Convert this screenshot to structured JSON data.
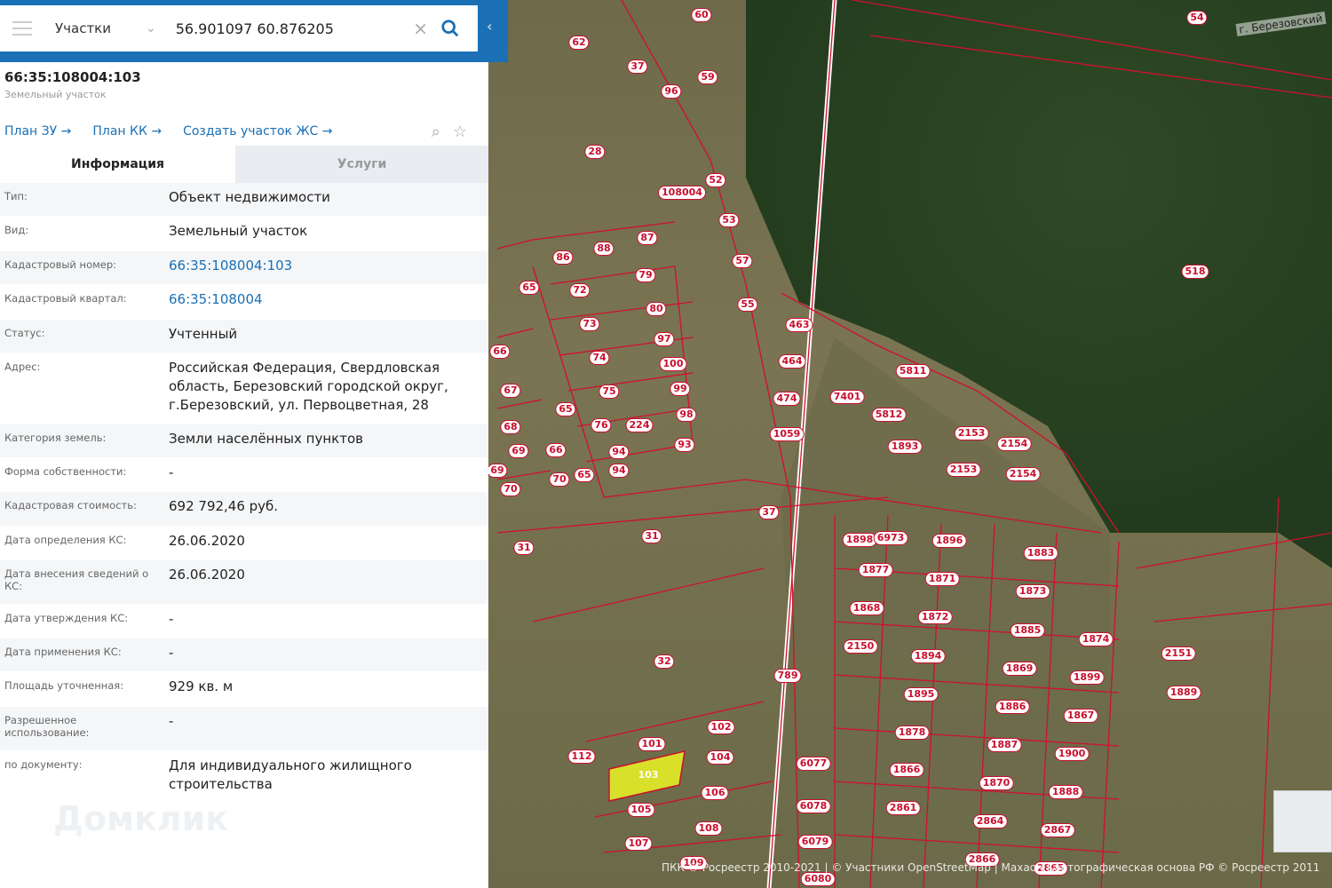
{
  "search": {
    "layer": "Участки",
    "query": "56.901097 60.876205"
  },
  "object": {
    "cadastral_number": "66:35:108004:103",
    "type_label": "Земельный участок"
  },
  "links": [
    "План ЗУ →",
    "План КК →",
    "Создать участок ЖС →"
  ],
  "tabs": [
    "Информация",
    "Услуги"
  ],
  "rows": [
    {
      "k": "Тип:",
      "v": "Объект недвижимости"
    },
    {
      "k": "Вид:",
      "v": "Земельный участок"
    },
    {
      "k": "Кадастровый номер:",
      "v": "66:35:108004:103"
    },
    {
      "k": "Кадастровый квартал:",
      "v": "66:35:108004"
    },
    {
      "k": "Статус:",
      "v": "Учтенный"
    },
    {
      "k": "Адрес:",
      "v": "Российская Федерация, Свердловская область, Березовский городской округ, г.Березовский, ул. Первоцветная, 28"
    },
    {
      "k": "Категория земель:",
      "v": "Земли населённых пунктов"
    },
    {
      "k": "Форма собственности:",
      "v": "-"
    },
    {
      "k": "Кадастровая стоимость:",
      "v": "692 792,46 руб."
    },
    {
      "k": "Дата определения КС:",
      "v": "26.06.2020"
    },
    {
      "k": "Дата внесения сведений о КС:",
      "v": "26.06.2020"
    },
    {
      "k": "Дата утверждения КС:",
      "v": "-"
    },
    {
      "k": "Дата применения КС:",
      "v": "-"
    },
    {
      "k": "Площадь уточненная:",
      "v": "929 кв. м"
    },
    {
      "k": "Разрешенное использование:",
      "v": "-"
    },
    {
      "k": "по документу:",
      "v": "Для индивидуального жилищного строительства"
    }
  ],
  "watermark": "Домклик",
  "map": {
    "street": "г. Березовский",
    "attribution": "ПКК © Росреестр 2010-2021 | © Участники OpenStreetMap | Махаон Картографическая основа РФ © Росреестр 2011",
    "labels": [
      "60",
      "62",
      "54",
      "37",
      "59",
      "96",
      "28",
      "108004",
      "53",
      "52",
      "57",
      "88",
      "87",
      "86",
      "79",
      "72",
      "55",
      "80",
      "73",
      "97",
      "74",
      "100",
      "75",
      "99",
      "76",
      "224",
      "98",
      "94",
      "93",
      "94",
      "31",
      "37",
      "31",
      "518",
      "463",
      "464",
      "474",
      "1059",
      "7401",
      "5811",
      "5812",
      "2153",
      "2154",
      "1893",
      "2153",
      "2154",
      "1898",
      "6973",
      "1896",
      "1883",
      "1877",
      "1871",
      "1873",
      "1868",
      "1872",
      "1885",
      "2150",
      "1894",
      "1874",
      "2151",
      "1869",
      "1895",
      "1899",
      "1886",
      "1867",
      "1889",
      "32",
      "101",
      "102",
      "103",
      "104",
      "106",
      "105",
      "107",
      "108",
      "109",
      "112",
      "1878",
      "1887",
      "1900",
      "1866",
      "1870",
      "1888",
      "2861",
      "2864",
      "2867",
      "2866",
      "2865",
      "6077",
      "6078",
      "6079",
      "6080",
      "789",
      "66",
      "67",
      "68",
      "69",
      "70",
      "65",
      "65",
      "66",
      "69",
      "70",
      "65"
    ]
  }
}
